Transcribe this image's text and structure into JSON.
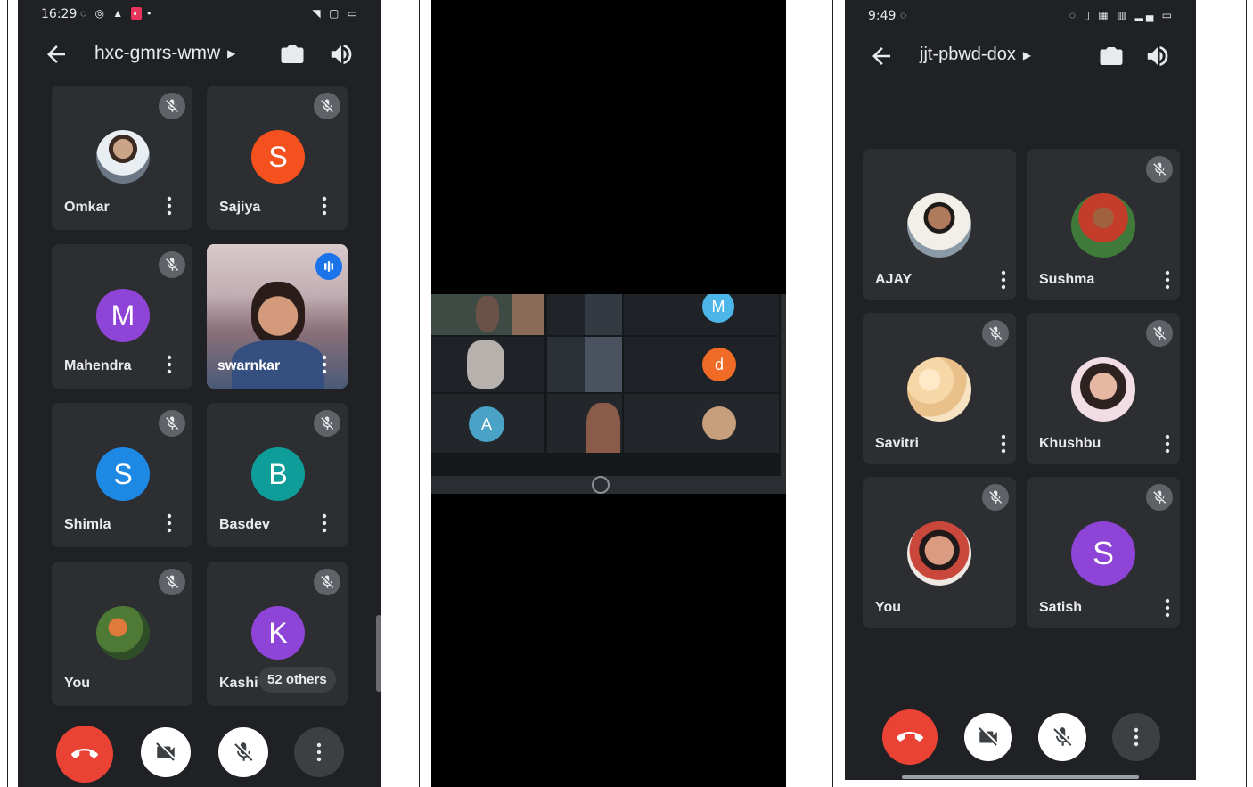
{
  "left_phone": {
    "status_time": "16:29",
    "meeting_code": "hxc-gmrs-wmw",
    "participants": [
      {
        "name": "Omkar",
        "initial": "",
        "color": "",
        "kind": "photo"
      },
      {
        "name": "Sajiya",
        "initial": "S",
        "color": "#f4511e",
        "kind": "letter"
      },
      {
        "name": "Mahendra",
        "initial": "M",
        "color": "#8e44d6",
        "kind": "letter"
      },
      {
        "name": "swarnkar",
        "initial": "",
        "color": "",
        "kind": "video"
      },
      {
        "name": "Shimla",
        "initial": "S",
        "color": "#1e88e5",
        "kind": "letter"
      },
      {
        "name": "Basdev",
        "initial": "B",
        "color": "#0f9d9a",
        "kind": "letter"
      },
      {
        "name": "You",
        "initial": "",
        "color": "",
        "kind": "photo"
      },
      {
        "name": "Kashi",
        "initial": "K",
        "color": "#8e44d6",
        "kind": "letter"
      }
    ],
    "others_chip": "52 others"
  },
  "middle_photo": {
    "tiles": [
      {
        "letter": "M",
        "color": "#4db6e8"
      },
      {
        "letter": "d",
        "color": "#f06b25"
      },
      {
        "letter": "A",
        "color": "#4aa3c6"
      }
    ]
  },
  "right_phone": {
    "status_time": "9:49",
    "meeting_code": "jjt-pbwd-dox",
    "participants": [
      {
        "name": "AJAY",
        "initial": "",
        "color": "",
        "kind": "photo"
      },
      {
        "name": "Sushma",
        "initial": "",
        "color": "",
        "kind": "photo"
      },
      {
        "name": "Savitri",
        "initial": "",
        "color": "",
        "kind": "photo"
      },
      {
        "name": "Khushbu",
        "initial": "",
        "color": "",
        "kind": "photo"
      },
      {
        "name": "You",
        "initial": "",
        "color": "",
        "kind": "photo"
      },
      {
        "name": "Satish",
        "initial": "S",
        "color": "#8e44d6",
        "kind": "letter"
      }
    ]
  },
  "colors": {
    "end_call_red": "#ea4335",
    "tile_bg": "#2d2e31",
    "screen_bg": "#202124"
  },
  "icons": [
    "back-arrow-icon",
    "switch-camera-icon",
    "speaker-icon",
    "mic-off-icon",
    "more-vert-icon",
    "end-call-icon",
    "camera-off-icon",
    "sound-wave-icon"
  ]
}
